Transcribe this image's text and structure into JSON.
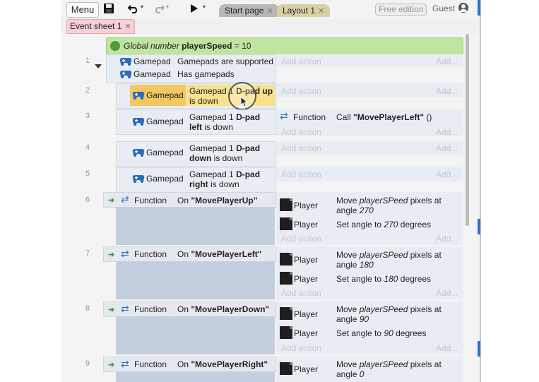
{
  "toolbar": {
    "menu_label": "Menu",
    "tabs": [
      {
        "label": "Start page"
      },
      {
        "label": "Layout 1"
      }
    ],
    "edition_label": "Free edition",
    "user_label": "Guest"
  },
  "sheet_tab": {
    "label": "Event sheet 1"
  },
  "global_var": {
    "prefix": "Global number",
    "name": "playerSpeed",
    "value": "= 10"
  },
  "events": [
    {
      "number": "1"
    },
    {
      "number": "2"
    },
    {
      "number": "3"
    },
    {
      "number": "4"
    },
    {
      "number": "5"
    },
    {
      "number": "6"
    },
    {
      "number": "7"
    },
    {
      "number": "8"
    },
    {
      "number": "9"
    }
  ],
  "e1": {
    "obj1": "Gamepad",
    "cond1": "Gamepads are supported",
    "obj2": "Gamepad",
    "cond2": "Has gamepads"
  },
  "e2": {
    "obj": "Gamepad",
    "cond_a": "Gamepad 1",
    "cond_b": "D-pad up",
    "cond_c": "is down"
  },
  "e3": {
    "obj": "Gamepad",
    "cond_a": "Gamepad 1",
    "cond_b": "D-pad",
    "cond_c": "left",
    "cond_d": "is down",
    "act_obj": "Function",
    "act_a": "Call",
    "act_b": "\"MovePlayerLeft\"",
    "act_c": "()"
  },
  "e4": {
    "obj": "Gamepad",
    "cond_a": "Gamepad 1",
    "cond_b": "D-pad",
    "cond_c": "down",
    "cond_d": "is down"
  },
  "e5": {
    "obj": "Gamepad",
    "cond_a": "Gamepad 1",
    "cond_b": "D-pad",
    "cond_c": "right",
    "cond_d": "is down"
  },
  "func_events": [
    {
      "obj": "Function",
      "on": "On",
      "name": "\"MovePlayerUp\"",
      "player1": "Player",
      "move_a": "Move",
      "move_b": "playerSPeed",
      "move_c": "pixels at",
      "move_d": "angle",
      "move_e": "270",
      "player2": "Player",
      "set_a": "Set angle to",
      "set_b": "270",
      "set_c": "degrees"
    },
    {
      "obj": "Function",
      "on": "On",
      "name": "\"MovePlayerLeft\"",
      "player1": "Player",
      "move_a": "Move",
      "move_b": "playerSPeed",
      "move_c": "pixels at",
      "move_d": "angle",
      "move_e": "180",
      "player2": "Player",
      "set_a": "Set angle to",
      "set_b": "180",
      "set_c": "degrees"
    },
    {
      "obj": "Function",
      "on": "On",
      "name": "\"MovePlayerDown\"",
      "player1": "Player",
      "move_a": "Move",
      "move_b": "playerSPeed",
      "move_c": "pixels at",
      "move_d": "angle",
      "move_e": "90",
      "player2": "Player",
      "set_a": "Set angle to",
      "set_b": "90",
      "set_c": "degrees"
    },
    {
      "obj": "Function",
      "on": "On",
      "name": "\"MovePlayerRight\"",
      "player1": "Player",
      "move_a": "Move",
      "move_b": "playerSPeed",
      "move_c": "pixels at",
      "move_d": "angle",
      "move_e": "0"
    }
  ],
  "add_action_label": "Add action",
  "add_dots_label": "Add...",
  "icons": {
    "save": "save-icon",
    "undo": "undo-icon",
    "redo": "redo-icon",
    "play": "play-icon",
    "globe": "globe-icon",
    "gamepad": "gamepad-icon",
    "function": "function-icon",
    "player": "player-sprite-icon",
    "user": "user-icon"
  },
  "colors": {
    "global_var_bg": "#c2e4a1",
    "highlight": "#f9e08c",
    "gray_block": "#c3cfdf",
    "sheet_tab": "#f7cfd4",
    "layout_tab": "#d9cfa5"
  }
}
